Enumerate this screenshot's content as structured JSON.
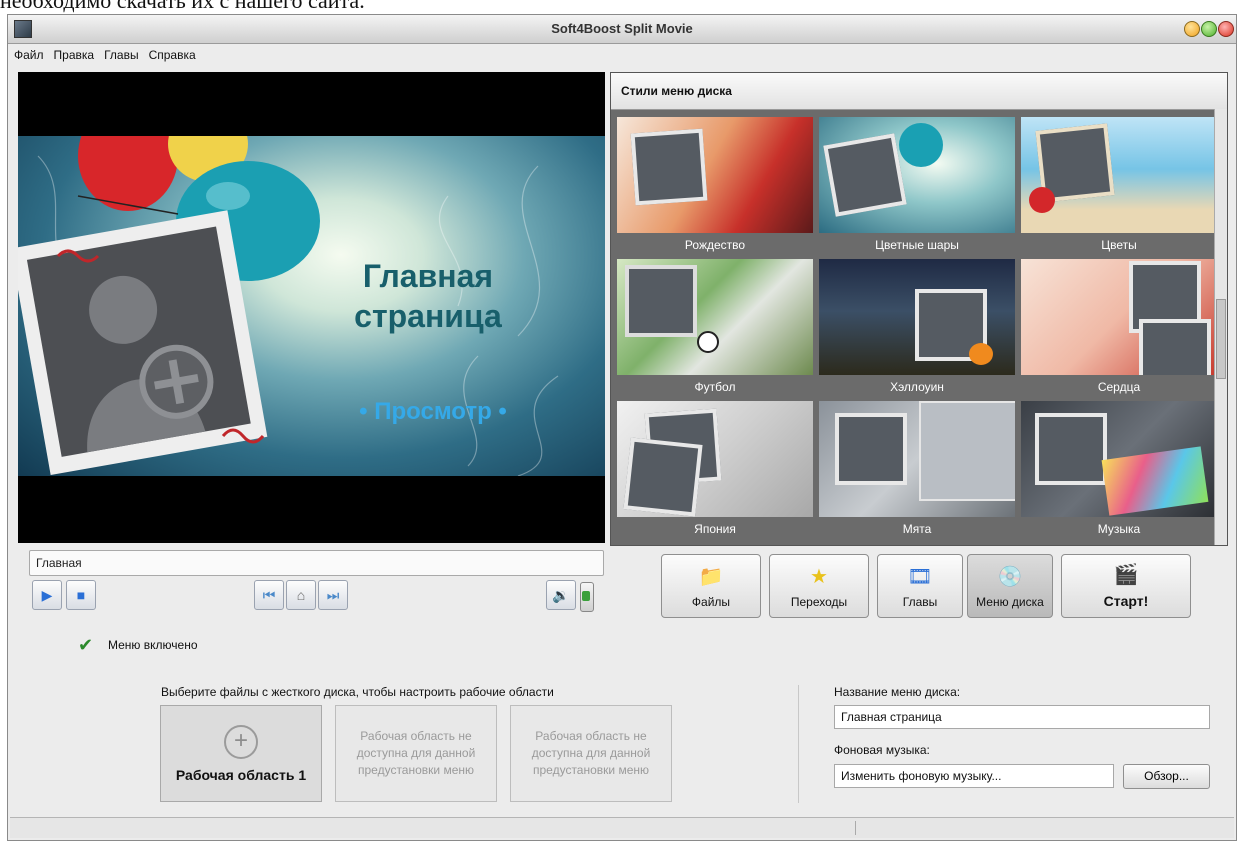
{
  "document_top_text": "необходимо скачать их с нашего сайта.",
  "window": {
    "title": "Soft4Boost Split Movie"
  },
  "menubar": [
    "Файл",
    "Правка",
    "Главы",
    "Справка"
  ],
  "preview": {
    "title_line1": "Главная",
    "title_line2": "страница",
    "subtitle": "• Просмотр •"
  },
  "styles_panel": {
    "heading": "Стили меню диска",
    "items": [
      {
        "label": "Рождество"
      },
      {
        "label": "Цветные шары"
      },
      {
        "label": "Цветы"
      },
      {
        "label": "Футбол"
      },
      {
        "label": "Хэллоуин"
      },
      {
        "label": "Сердца"
      },
      {
        "label": "Япония"
      },
      {
        "label": "Мята"
      },
      {
        "label": "Музыка"
      }
    ]
  },
  "breadcrumb": {
    "item": "Главная"
  },
  "tabs": {
    "files": "Файлы",
    "transitions": "Переходы",
    "chapters": "Главы",
    "disc_menu": "Меню диска",
    "start": "Старт!"
  },
  "menu_enabled_label": "Меню включено",
  "workspaces": {
    "hint": "Выберите файлы с жесткого диска, чтобы настроить рабочие области",
    "ws1": "Рабочая область 1",
    "disabled_text": "Рабочая область не доступна для данной предустановки меню"
  },
  "disc_menu": {
    "name_label": "Название меню диска:",
    "name_value": "Главная страница",
    "music_label": "Фоновая музыка:",
    "music_value": "Изменить фоновую музыку...",
    "browse_button": "Обзор..."
  }
}
